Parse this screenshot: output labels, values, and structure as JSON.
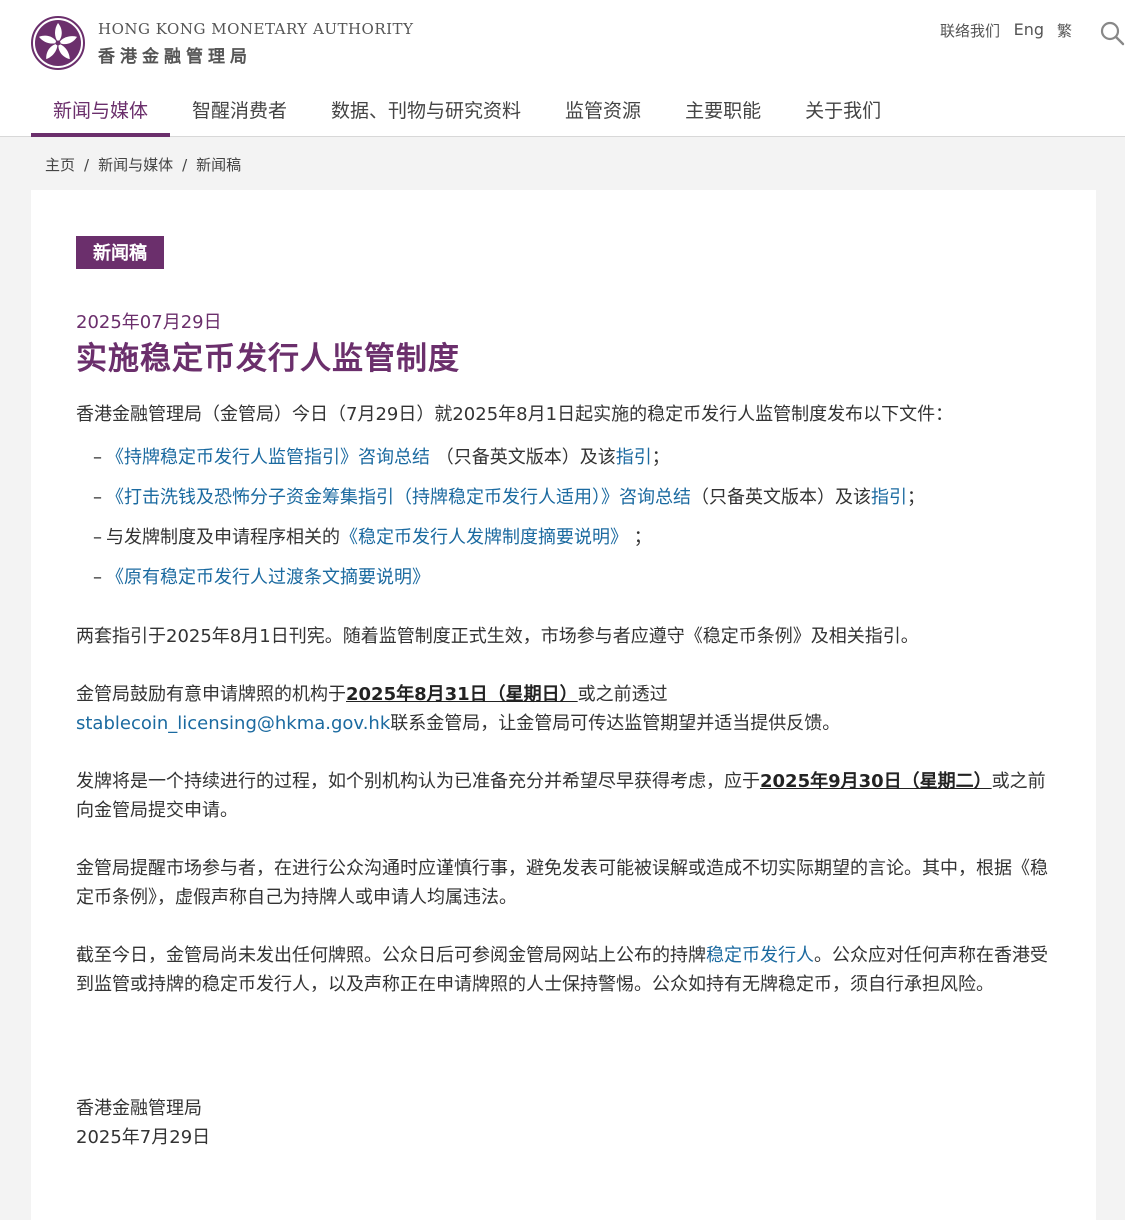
{
  "header": {
    "org_name_en": "HONG KONG MONETARY AUTHORITY",
    "org_name_zh": "香港金融管理局",
    "contact_label": "联络我们",
    "lang_en_label": "Eng",
    "lang_trad_label": "繁",
    "search_icon": "search-icon",
    "logo_icon": "bauhinia-logo-icon"
  },
  "nav": {
    "items": [
      {
        "label": "新闻与媒体",
        "active": true
      },
      {
        "label": "智醒消费者",
        "active": false
      },
      {
        "label": "数据、刊物与研究资料",
        "active": false
      },
      {
        "label": "监管资源",
        "active": false
      },
      {
        "label": "主要职能",
        "active": false
      },
      {
        "label": "关于我们",
        "active": false
      }
    ]
  },
  "breadcrumb": [
    "主页",
    "新闻与媒体",
    "新闻稿"
  ],
  "article": {
    "tag": "新闻稿",
    "date": "2025年07月29日",
    "title": "实施稳定币发行人监管制度",
    "intro": "香港金融管理局（金管局）今日（7月29日）就2025年8月1日起实施的稳定币发行人监管制度发布以下文件：",
    "list": [
      {
        "dash": "–",
        "link1": "《持牌稳定币发行人监管指引》咨询总结",
        "text1": " （只备英文版本）及该",
        "link2": "指引",
        "text2": "；"
      },
      {
        "dash": "–",
        "link1": "《打击洗钱及恐怖分子资金筹集指引（持牌稳定币发行人适用）》咨询总结",
        "text1": "（只备英文版本）及该",
        "link2": "指引",
        "text2": "；"
      },
      {
        "dash": "–",
        "pre": "与发牌制度及申请程序相关的",
        "link1": "《稳定币发行人发牌制度摘要说明》",
        "text1": " ；"
      },
      {
        "dash": "–",
        "link1": "《原有稳定币发行人过渡条文摘要说明》"
      }
    ],
    "para2": "两套指引于2025年8月1日刊宪。随着监管制度正式生效，市场参与者应遵守《稳定币条例》及相关指引。",
    "para3": {
      "pre": "金管局鼓励有意申请牌照的机构于",
      "strong": "2025年8月31日（星期日）",
      "mid": "或之前透过",
      "email": "stablecoin_licensing@hkma.gov.hk",
      "post": "联系金管局，让金管局可传达监管期望并适当提供反馈。"
    },
    "para4": {
      "pre": "发牌将是一个持续进行的过程，如个别机构认为已准备充分并希望尽早获得考虑，应于",
      "strong": "2025年9月30日（星期二）",
      "post": "或之前向金管局提交申请。"
    },
    "para5": "金管局提醒市场参与者，在进行公众沟通时应谨慎行事，避免发表可能被误解或造成不切实际期望的言论。其中，根据《稳定币条例》，虚假声称自己为持牌人或申请人均属违法。",
    "para6": {
      "pre": "截至今日，金管局尚未发出任何牌照。公众日后可参阅金管局网站上公布的持牌",
      "link": "稳定币发行人",
      "post": "。公众应对任何声称在香港受到监管或持牌的稳定币发行人，以及声称正在申请牌照的人士保持警惕。公众如持有无牌稳定币，须自行承担风险。"
    },
    "sign_org": "香港金融管理局",
    "sign_date": "2025年7月29日"
  },
  "colors": {
    "brand_purple": "#6b2f6c",
    "link_blue": "#1b6aa0"
  }
}
